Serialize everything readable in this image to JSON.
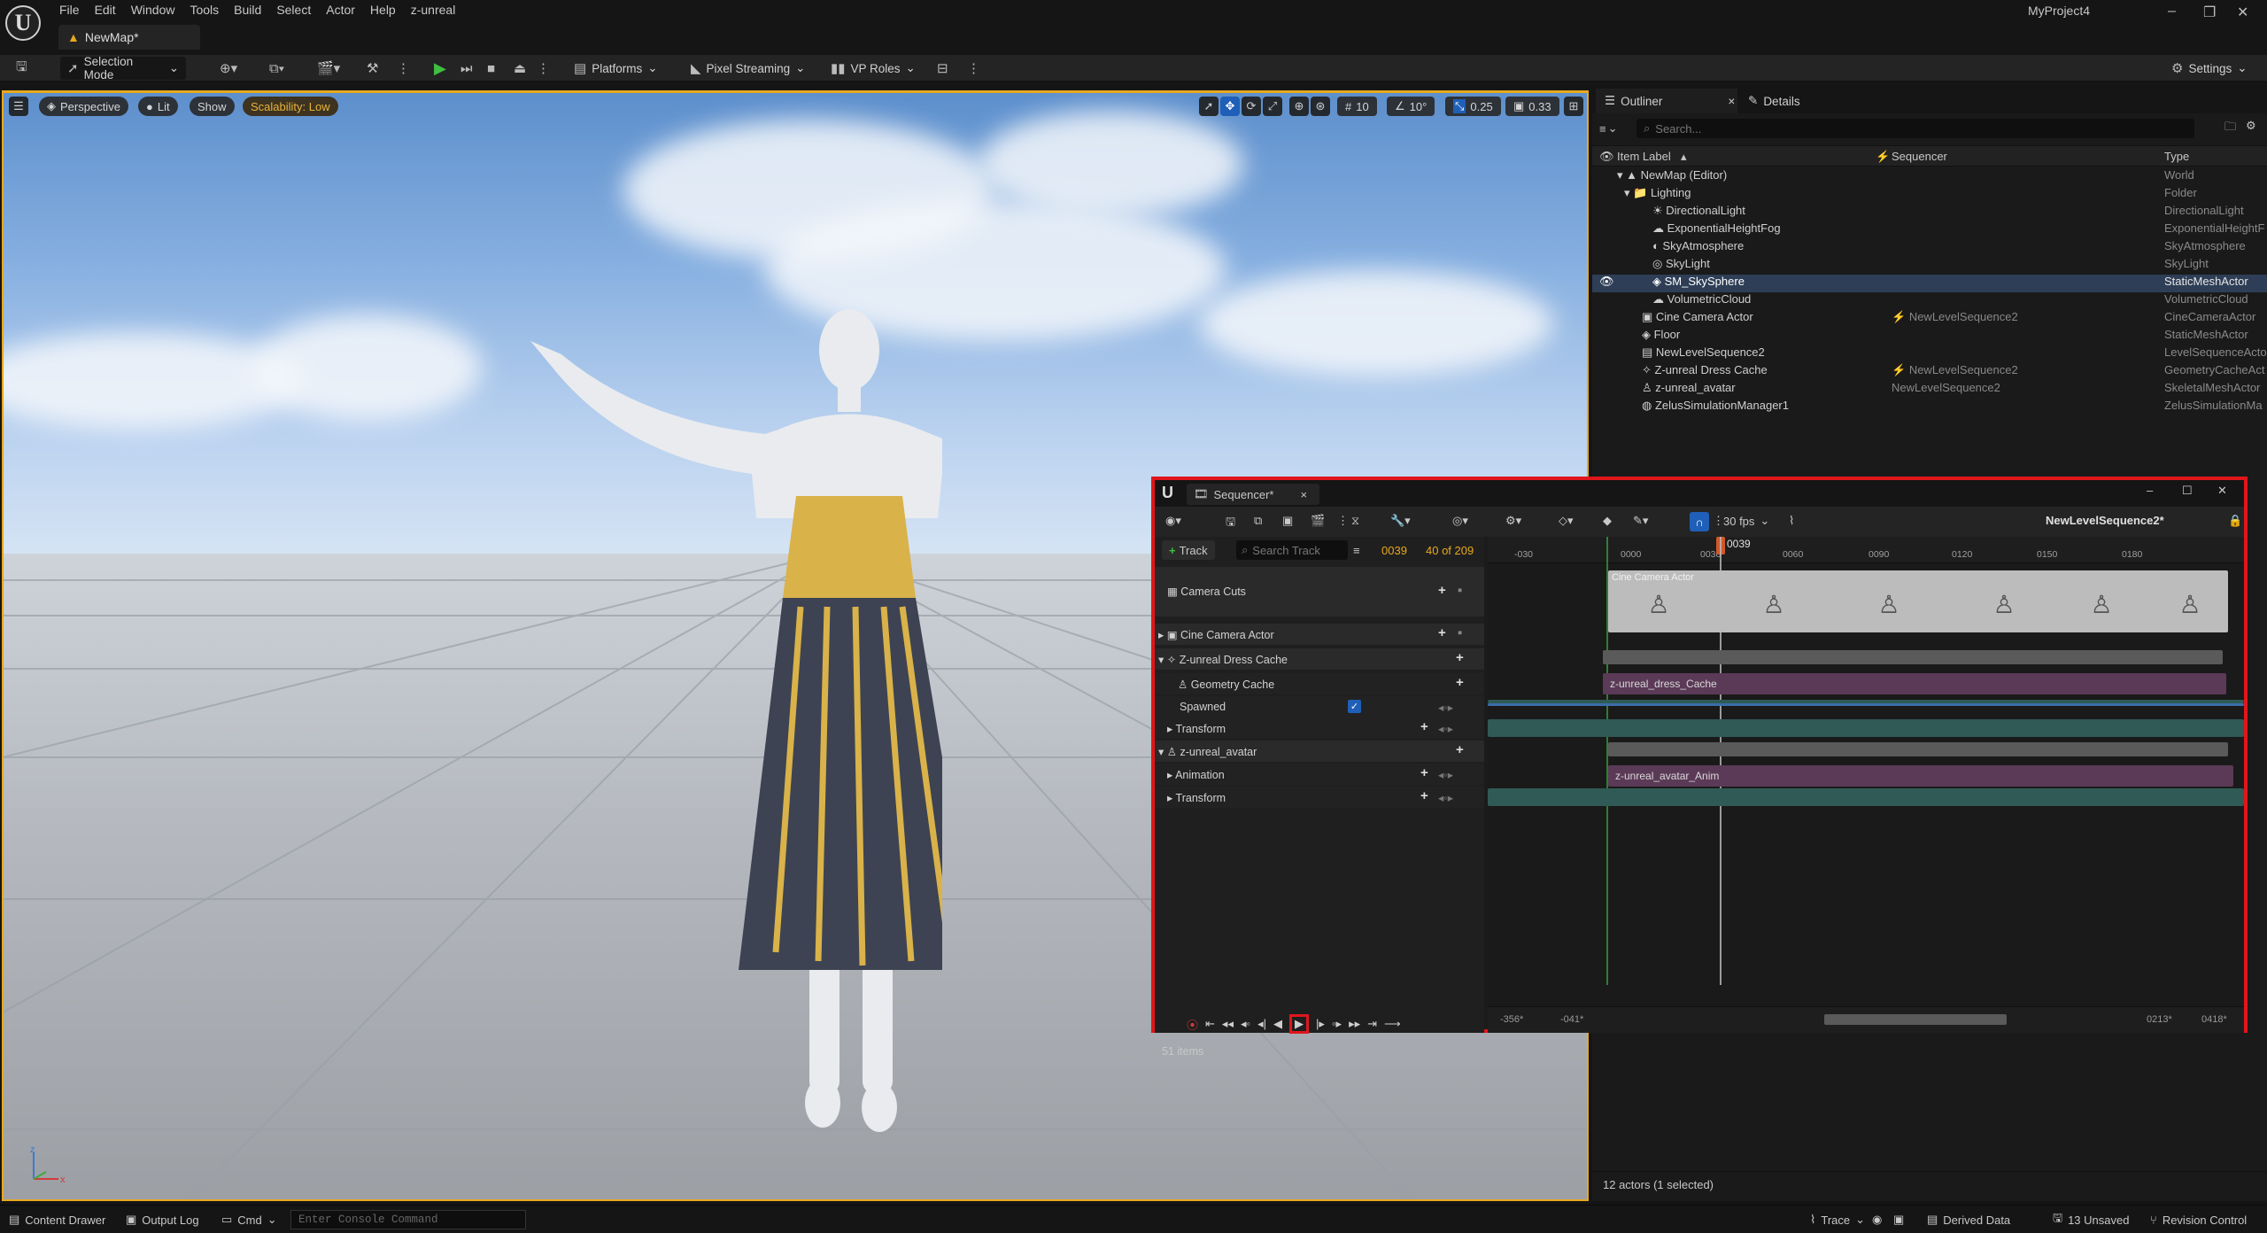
{
  "colors": {
    "accent": "#e8a81e",
    "highlight_red": "#e0161b",
    "play_green": "#3fbf3f",
    "selection": "#2e3e56",
    "track_purple": "#5b3a57",
    "track_teal": "#2f5a55"
  },
  "menu": [
    "File",
    "Edit",
    "Window",
    "Tools",
    "Build",
    "Select",
    "Actor",
    "Help",
    "z-unreal"
  ],
  "project": "MyProject4",
  "map_tab": "NewMap*",
  "toolbar": {
    "selection_mode": "Selection Mode",
    "platforms": "Platforms",
    "pixel_streaming": "Pixel Streaming",
    "vp_roles": "VP Roles",
    "settings": "Settings"
  },
  "viewport": {
    "perspective": "Perspective",
    "lit": "Lit",
    "show": "Show",
    "scalability": "Scalability: Low",
    "grid": "10",
    "angle": "10°",
    "scale": "0.25",
    "camera_speed": "0.33"
  },
  "outliner": {
    "tab_outliner": "Outliner",
    "tab_details": "Details",
    "search_placeholder": "Search...",
    "col_label": "Item Label",
    "col_sequencer": "Sequencer",
    "col_type": "Type",
    "rows": [
      {
        "label": "NewMap (Editor)",
        "seq": "",
        "type": "World"
      },
      {
        "label": "Lighting",
        "seq": "",
        "type": "Folder"
      },
      {
        "label": "DirectionalLight",
        "seq": "",
        "type": "DirectionalLight"
      },
      {
        "label": "ExponentialHeightFog",
        "seq": "",
        "type": "ExponentialHeightF"
      },
      {
        "label": "SkyAtmosphere",
        "seq": "",
        "type": "SkyAtmosphere"
      },
      {
        "label": "SkyLight",
        "seq": "",
        "type": "SkyLight"
      },
      {
        "label": "SM_SkySphere",
        "seq": "",
        "type": "StaticMeshActor"
      },
      {
        "label": "VolumetricCloud",
        "seq": "",
        "type": "VolumetricCloud"
      },
      {
        "label": "Cine Camera Actor",
        "seq": "NewLevelSequence2",
        "type": "CineCameraActor"
      },
      {
        "label": "Floor",
        "seq": "",
        "type": "StaticMeshActor"
      },
      {
        "label": "NewLevelSequence2",
        "seq": "",
        "type": "LevelSequenceActo"
      },
      {
        "label": "Z-unreal Dress Cache",
        "seq": "NewLevelSequence2",
        "type": "GeometryCacheAct"
      },
      {
        "label": "z-unreal_avatar",
        "seq": "NewLevelSequence2",
        "type": "SkeletalMeshActor"
      },
      {
        "label": "ZelusSimulationManager1",
        "seq": "",
        "type": "ZelusSimulationMa"
      }
    ],
    "footer": "12 actors (1 selected)"
  },
  "statusbar": {
    "content_drawer": "Content Drawer",
    "output_log": "Output Log",
    "cmd": "Cmd",
    "console_placeholder": "Enter Console Command",
    "trace": "Trace",
    "derived_data": "Derived Data",
    "unsaved": "13 Unsaved",
    "revision_control": "Revision Control"
  },
  "sequencer": {
    "tab": "Sequencer*",
    "fps": "30 fps",
    "sequence_name": "NewLevelSequence2*",
    "add_track": "Track",
    "search_placeholder": "Search Track",
    "current_frame": "0039",
    "frame_count": "40 of 209",
    "playhead_label": "0039",
    "tracks": [
      {
        "name": "Camera Cuts"
      },
      {
        "name": "Cine Camera Actor"
      },
      {
        "name": "Z-unreal Dress Cache"
      },
      {
        "name": "Geometry Cache"
      },
      {
        "name": "Spawned"
      },
      {
        "name": "Transform"
      },
      {
        "name": "z-unreal_avatar"
      },
      {
        "name": "Animation"
      },
      {
        "name": "Transform"
      }
    ],
    "ruler": [
      "-030",
      "0000",
      "0030",
      "0060",
      "0090",
      "0120",
      "0150",
      "0180"
    ],
    "clip_camera": "Cine Camera Actor",
    "clip_dress": "z-unreal_dress_Cache",
    "clip_anim": "z-unreal_avatar_Anim",
    "items": "51 items",
    "range_start_out": "-356*",
    "range_start_in": "-041*",
    "range_end_in": "0213*",
    "range_end_out": "0418*"
  }
}
